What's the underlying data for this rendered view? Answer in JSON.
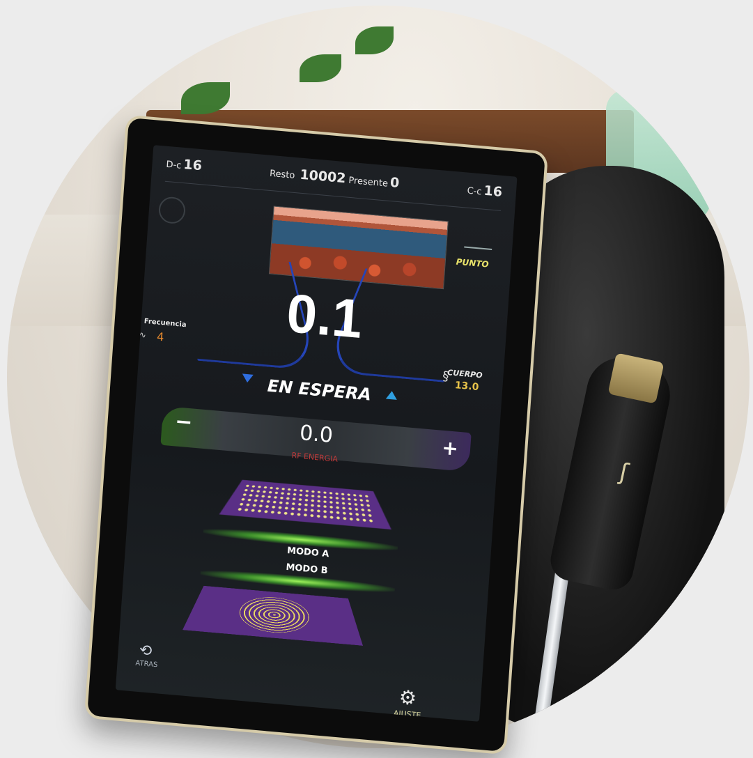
{
  "header": {
    "d_label": "D-c",
    "d_value": "16",
    "resto_label": "Resto",
    "resto_value": "10002",
    "presente_label": "Presente",
    "presente_value": "0",
    "cc_label": "C-c",
    "cc_value": "16"
  },
  "treatment": {
    "mode_label": "PUNTO",
    "main_value": "0.1",
    "frequency_label": "Frecuencia",
    "frequency_value": "4",
    "zone_label": "CUERPO",
    "zone_value": "13.0",
    "status": "EN ESPERA"
  },
  "energy": {
    "value": "0.0",
    "label": "RF ENERGIA",
    "minus": "−",
    "plus": "+"
  },
  "modes": {
    "mode_a": "MODO A",
    "mode_b": "MODO B"
  },
  "footer": {
    "back_label": "ATRAS",
    "settings_label": "AJUSTE"
  },
  "icons": {
    "back": "back-icon",
    "settings": "gear-icon",
    "frequency": "wave-icon",
    "zone": "body-icon",
    "punto": "applicator-icon"
  },
  "colors": {
    "accent_yellow": "#e8e26a",
    "frequency_orange": "#e78a2e",
    "energy_red": "#c03a3a",
    "mode_purple": "#5a2f86",
    "glow_green": "#9cf05a"
  }
}
